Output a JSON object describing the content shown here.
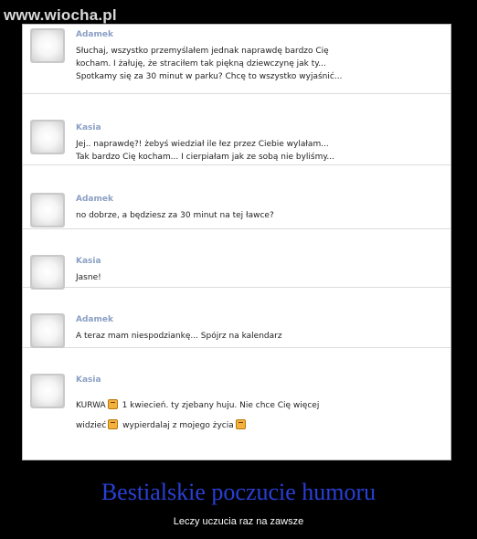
{
  "watermark": "www.wiocha.pl",
  "messages": [
    {
      "sender": "Adamek",
      "text": "Słuchaj, wszystko przemyślałem jednak naprawdę bardzo Cię\nkocham. I żałuję, że straciłem tak piękną dziewczynę jak ty...\nSpotkamy się za 30 minut w parku? Chcę to wszystko wyjaśnić..."
    },
    {
      "sender": "Kasia",
      "text": "Jej.. naprawdę?! żebyś wiedział ile łez przez Ciebie wylałam...\nTak bardzo Cię kocham... I cierpiałam jak ze sobą nie byliśmy..."
    },
    {
      "sender": "Adamek",
      "text": "no dobrze, a będziesz za 30 minut na tej ławce?"
    },
    {
      "sender": "Kasia",
      "text": "Jasne!"
    },
    {
      "sender": "Adamek",
      "text": "A teraz mam niespodziankę... Spójrz na kalendarz"
    },
    {
      "sender": "Kasia",
      "text_parts": [
        "KURWA",
        "1 kwiecień. ty zjebany huju. Nie chce Cię więcej",
        "widzieć",
        "wypierdalaj z mojego życia"
      ]
    }
  ],
  "caption": {
    "title": "Bestialskie poczucie humoru",
    "subtitle": "Leczy uczucia raz na zawsze"
  },
  "colors": {
    "background": "#000000",
    "sender": "#8a9fc4",
    "title": "#2840d6",
    "emoticon": "#f3b23d"
  }
}
